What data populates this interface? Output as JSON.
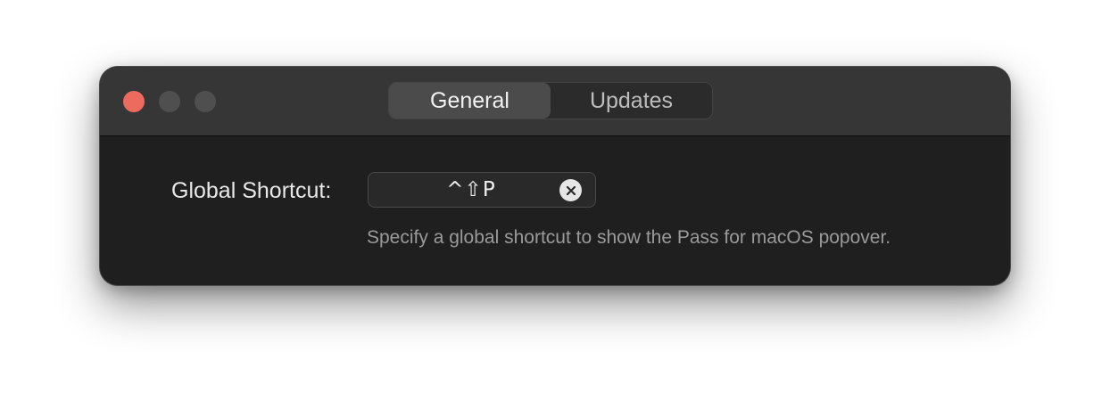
{
  "window": {
    "controls": [
      "close",
      "minimize",
      "maximize"
    ]
  },
  "tabs": [
    {
      "label": "General",
      "selected": true
    },
    {
      "label": "Updates",
      "selected": false
    }
  ],
  "settings": {
    "global_shortcut": {
      "label": "Global Shortcut:",
      "value": "^⇧P",
      "clear_icon": "clear-circle-x-icon",
      "description": "Specify a global shortcut to show the Pass for macOS popover."
    }
  },
  "colors": {
    "close": "#ec6a5e",
    "inactive_control": "#4f4f4f",
    "titlebar": "#363636",
    "background": "#1f1f1f"
  }
}
